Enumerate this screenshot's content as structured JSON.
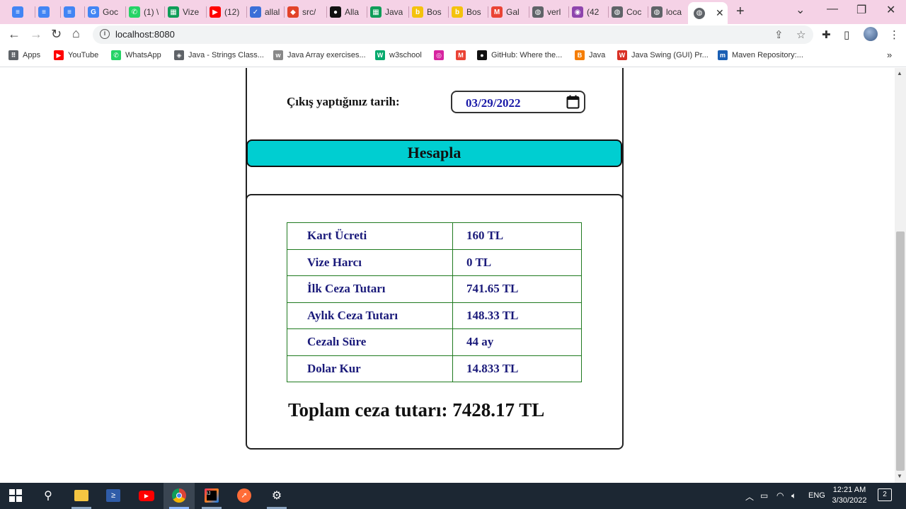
{
  "browser": {
    "tabs": [
      {
        "label": "",
        "icon": "docs-icon",
        "color": "#4285f4"
      },
      {
        "label": "",
        "icon": "docs-icon",
        "color": "#4285f4"
      },
      {
        "label": "",
        "icon": "docs-icon",
        "color": "#4285f4"
      },
      {
        "label": "Goc",
        "icon": "translate-icon",
        "color": "#4285f4"
      },
      {
        "label": "(1) \\",
        "icon": "whatsapp-icon",
        "color": "#25d366"
      },
      {
        "label": "Vize",
        "icon": "sheets-icon",
        "color": "#0f9d58"
      },
      {
        "label": "(12)",
        "icon": "youtube-icon",
        "color": "#ff0000"
      },
      {
        "label": "allal",
        "icon": "tasks-icon",
        "color": "#3b6fd8"
      },
      {
        "label": "src/",
        "icon": "gitlab-icon",
        "color": "#e24329"
      },
      {
        "label": "Alla",
        "icon": "github-icon",
        "color": "#111111"
      },
      {
        "label": "Java",
        "icon": "sheets-icon",
        "color": "#0f9d58"
      },
      {
        "label": "Bos",
        "icon": "b-icon",
        "color": "#f4c20d"
      },
      {
        "label": "Bos",
        "icon": "b-icon",
        "color": "#f4c20d"
      },
      {
        "label": "Gal",
        "icon": "gmail-icon",
        "color": "#ea4335"
      },
      {
        "label": "verl",
        "icon": "globe-icon",
        "color": "#5f6368"
      },
      {
        "label": "(42",
        "icon": "tracker-icon",
        "color": "#8e44ad"
      },
      {
        "label": "Coc",
        "icon": "globe-icon",
        "color": "#5f6368"
      },
      {
        "label": "loca",
        "icon": "globe-icon",
        "color": "#5f6368"
      }
    ],
    "active_tab": {
      "label": "",
      "icon": "globe-icon"
    },
    "url": "localhost:8080",
    "bookmarks": [
      {
        "label": "Apps",
        "icon": "apps-grid-icon",
        "color": "#5f6368"
      },
      {
        "label": "YouTube",
        "icon": "youtube-icon",
        "color": "#ff0000"
      },
      {
        "label": "WhatsApp",
        "icon": "whatsapp-icon",
        "color": "#25d366"
      },
      {
        "label": "Java - Strings Class...",
        "icon": "java-tpoint-icon",
        "color": "#5f6368"
      },
      {
        "label": "Java Array exercises...",
        "icon": "w3r-icon",
        "color": "#888888"
      },
      {
        "label": "w3school",
        "icon": "w3-icon",
        "color": "#04aa6d"
      },
      {
        "label": "",
        "icon": "instagram-icon",
        "color": "#d6249f"
      },
      {
        "label": "",
        "icon": "gmail-icon",
        "color": "#ea4335"
      },
      {
        "label": "GitHub: Where the...",
        "icon": "github-icon",
        "color": "#111111"
      },
      {
        "label": "Java",
        "icon": "blogger-icon",
        "color": "#f57d00"
      },
      {
        "label": "Java Swing (GUI) Pr...",
        "icon": "w3resource-icon",
        "color": "#d93025"
      },
      {
        "label": "Maven Repository:...",
        "icon": "maven-icon",
        "color": "#1a5fb4"
      }
    ]
  },
  "page": {
    "date_label": "Çıkış yaptığınız tarih:",
    "date_value": "03/29/2022",
    "calc_button": "Hesapla",
    "results": [
      {
        "key": "Kart Ücreti",
        "value": "160 TL"
      },
      {
        "key": "Vize Harcı",
        "value": "0 TL"
      },
      {
        "key": "İlk Ceza Tutarı",
        "value": "741.65 TL"
      },
      {
        "key": "Aylık Ceza Tutarı",
        "value": "148.33 TL"
      },
      {
        "key": "Cezalı Süre",
        "value": "44 ay"
      },
      {
        "key": "Dolar Kur",
        "value": "14.833 TL"
      }
    ],
    "total": "Toplam ceza tutarı: 7428.17 TL"
  },
  "taskbar": {
    "language": "ENG",
    "time": "12:21 AM",
    "date": "3/30/2022",
    "notifications": "2"
  }
}
